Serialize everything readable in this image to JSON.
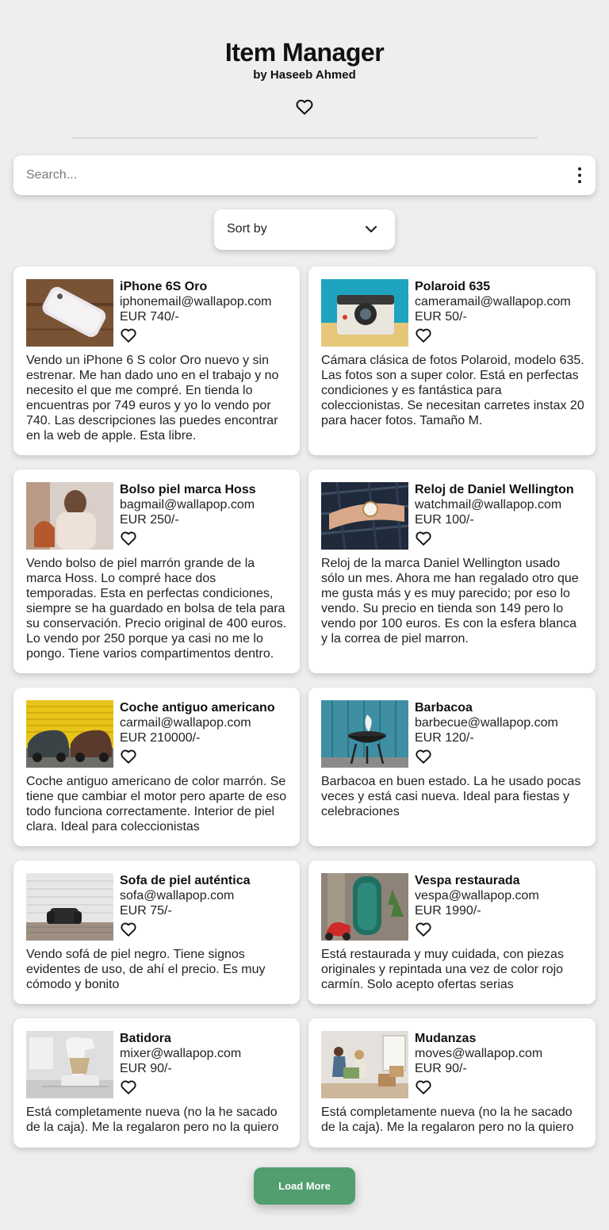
{
  "header": {
    "title": "Item Manager",
    "subtitle": "by Haseeb Ahmed"
  },
  "search": {
    "placeholder": "Search..."
  },
  "sort": {
    "label": "Sort by"
  },
  "items": [
    {
      "name": "iPhone 6S Oro",
      "email": "iphonemail@wallapop.com",
      "price": "EUR 740/-",
      "description": "Vendo un iPhone 6 S color Oro nuevo y sin estrenar. Me han dado uno en el trabajo y no necesito el que me compré. En tienda lo encuentras por 749 euros y yo lo vendo por 740. Las descripciones las puedes encontrar en la web de apple. Esta libre."
    },
    {
      "name": "Polaroid 635",
      "email": "cameramail@wallapop.com",
      "price": "EUR 50/-",
      "description": "Cámara clásica de fotos Polaroid, modelo 635. Las fotos son a super color. Está en perfectas condiciones y es fantástica para coleccionistas. Se necesitan carretes instax 20 para hacer fotos. Tamaño M."
    },
    {
      "name": "Bolso piel marca Hoss",
      "email": "bagmail@wallapop.com",
      "price": "EUR 250/-",
      "description": "Vendo bolso de piel marrón grande de la marca Hoss. Lo compré hace dos temporadas. Esta en perfectas condiciones, siempre se ha guardado en bolsa de tela para su conservación. Precio original de 400 euros. Lo vendo por 250 porque ya casi no me lo pongo. Tiene varios compartimentos dentro."
    },
    {
      "name": "Reloj de Daniel Wellington",
      "email": "watchmail@wallapop.com",
      "price": "EUR 100/-",
      "description": "Reloj de la marca Daniel Wellington usado sólo un mes. Ahora me han regalado otro que me gusta más y es muy parecido; por eso lo vendo. Su precio en tienda son 149 pero lo vendo por 100 euros. Es con la esfera blanca y la correa de piel marron."
    },
    {
      "name": "Coche antiguo americano",
      "email": "carmail@wallapop.com",
      "price": "EUR 210000/-",
      "description": "Coche antiguo americano de color marrón. Se tiene que cambiar el motor pero aparte de eso todo funciona correctamente. Interior de piel clara. Ideal para coleccionistas"
    },
    {
      "name": "Barbacoa",
      "email": "barbecue@wallapop.com",
      "price": "EUR 120/-",
      "description": "Barbacoa en buen estado. La he usado pocas veces y está casi nueva. Ideal para fiestas y celebraciones"
    },
    {
      "name": "Sofa de piel auténtica",
      "email": "sofa@wallapop.com",
      "price": "EUR 75/-",
      "description": "Vendo sofá de piel negro. Tiene signos evidentes de uso, de ahí el precio. Es muy cómodo y bonito"
    },
    {
      "name": "Vespa restaurada",
      "email": "vespa@wallapop.com",
      "price": "EUR 1990/-",
      "description": "Está restaurada y muy cuidada, con piezas originales y repintada una vez de color rojo carmín. Solo acepto ofertas serias"
    },
    {
      "name": "Batidora",
      "email": "mixer@wallapop.com",
      "price": "EUR 90/-",
      "description": "Está completamente nueva (no la he sacado de la caja). Me la regalaron pero no la quiero"
    },
    {
      "name": "Mudanzas",
      "email": "moves@wallapop.com",
      "price": "EUR 90/-",
      "description": "Está completamente nueva (no la he sacado de la caja). Me la regalaron pero no la quiero"
    }
  ],
  "load_more": {
    "label": "Load More"
  },
  "icons": {
    "favorite": "heart-outline-icon",
    "menu": "kebab-menu-icon",
    "sort": "chevron-down-icon"
  },
  "colors": {
    "background": "#eeeeef",
    "card": "#ffffff",
    "accent": "#529e6f"
  }
}
